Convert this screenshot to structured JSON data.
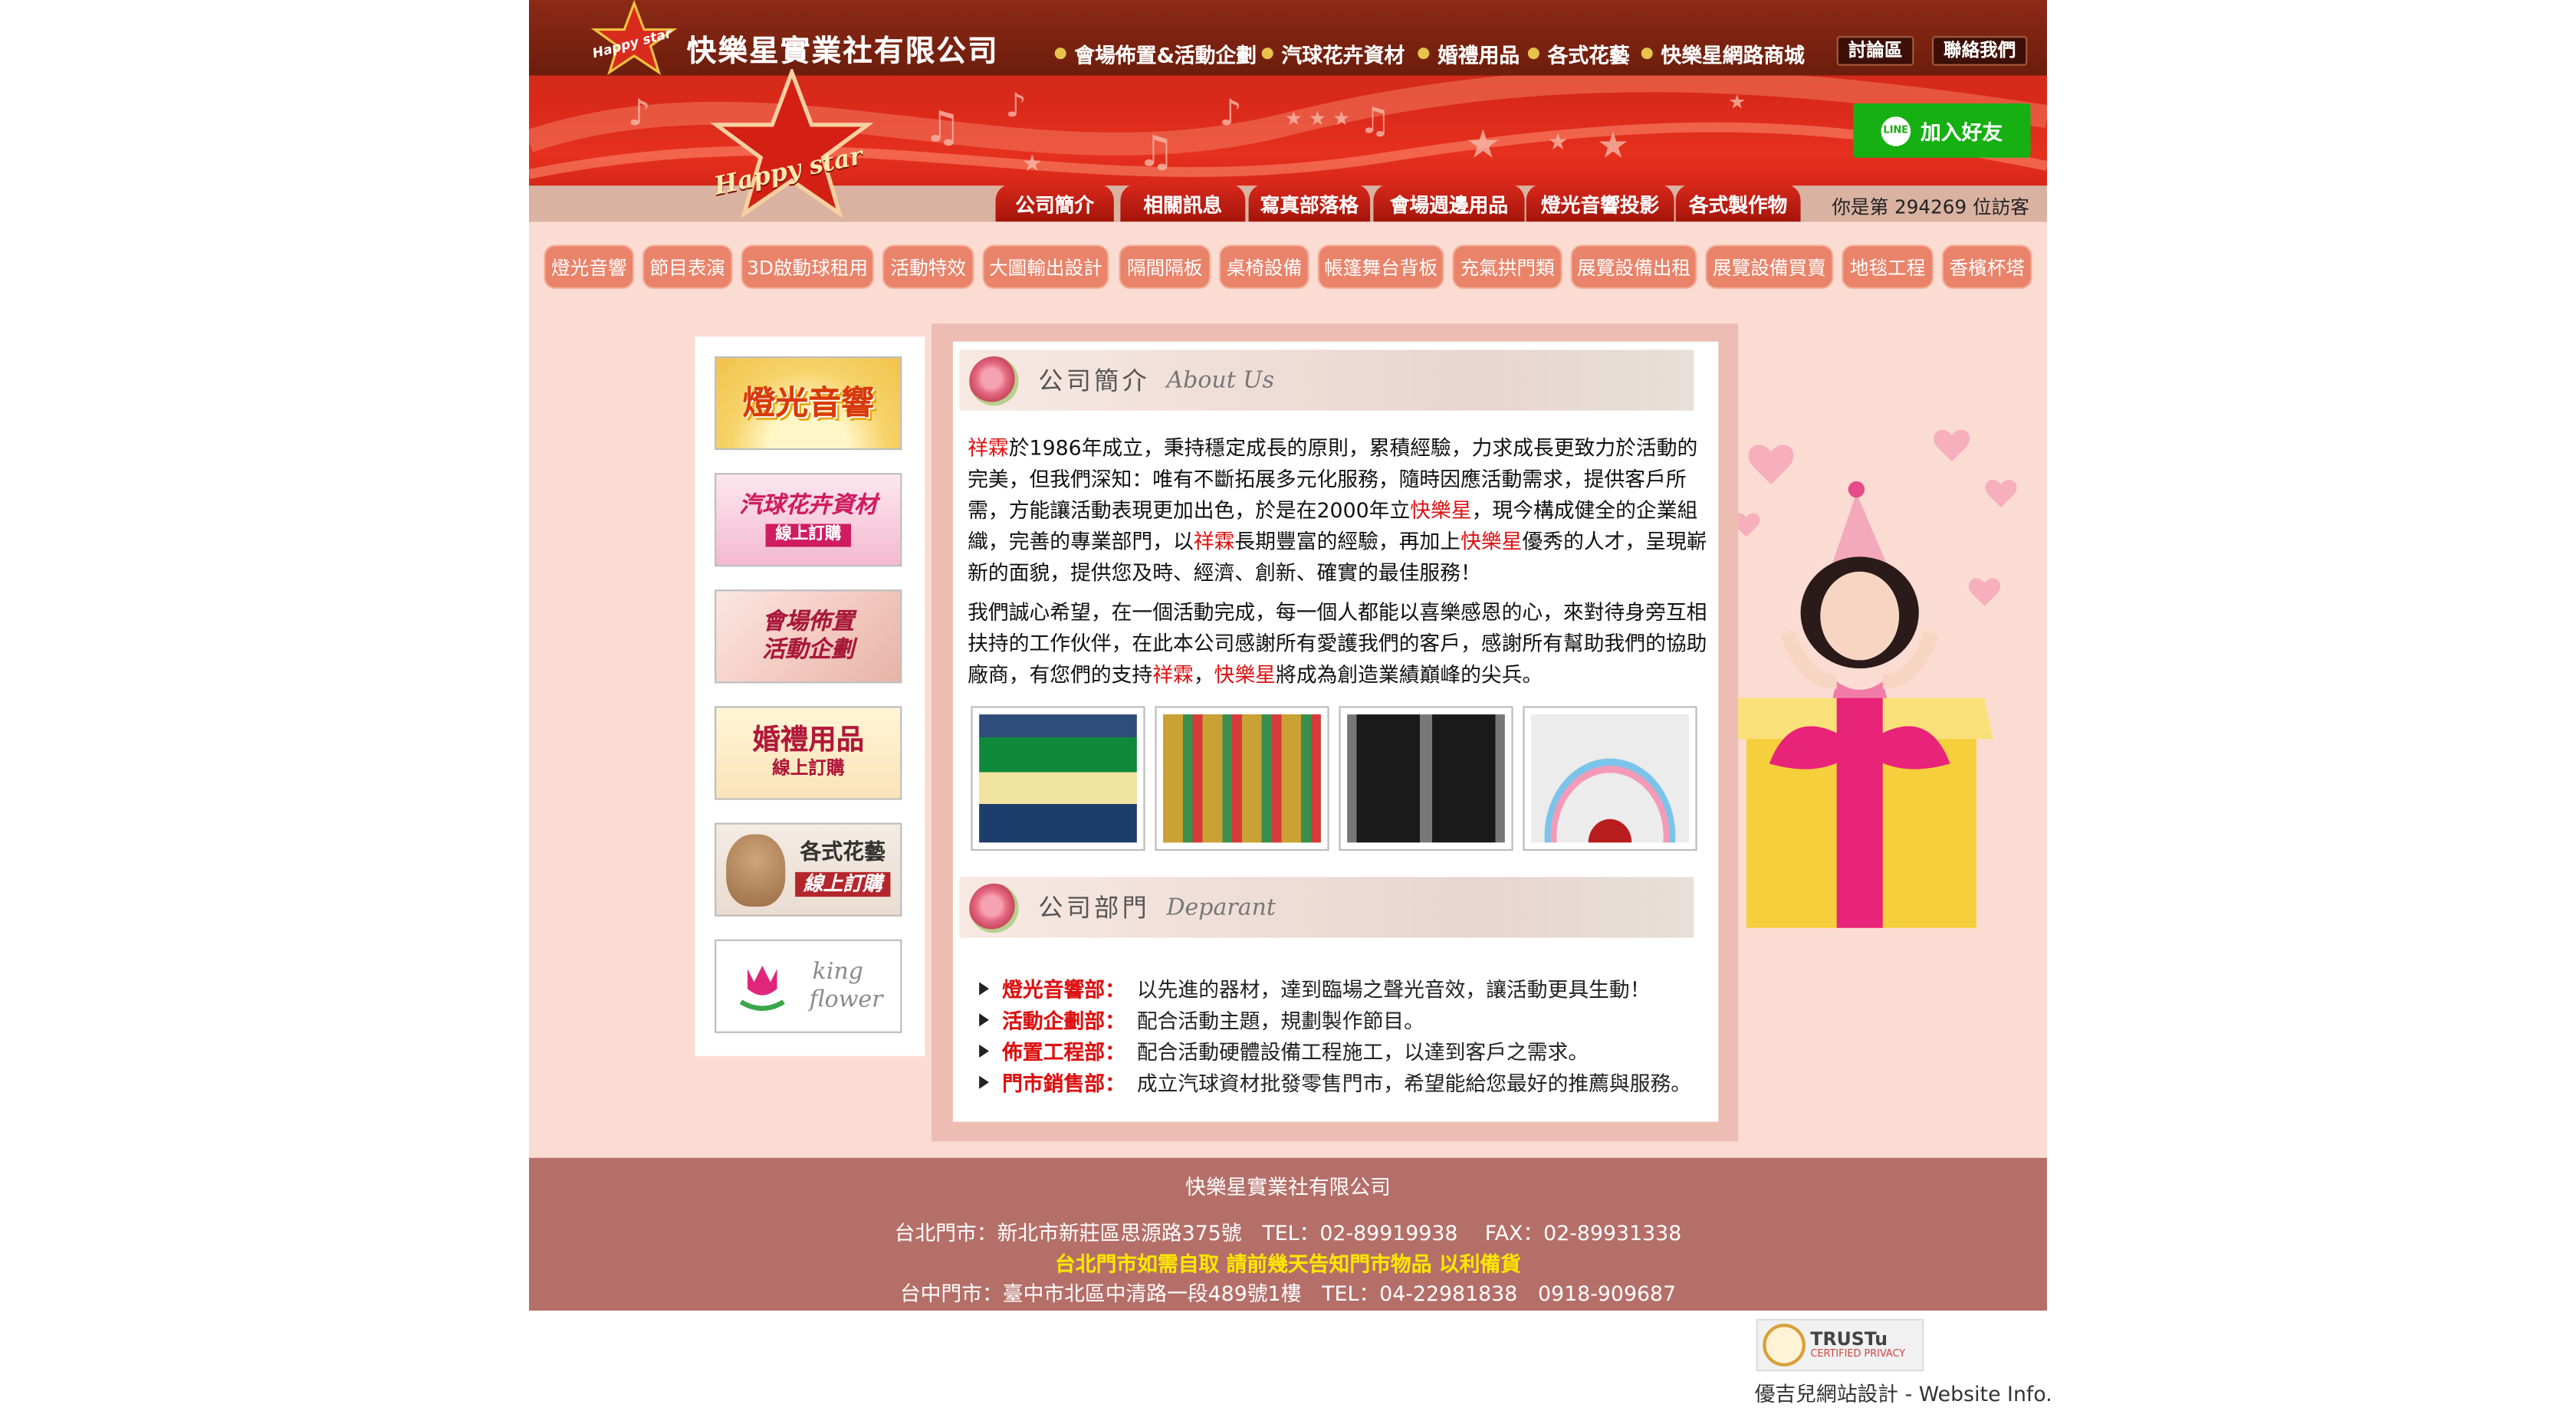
{
  "brand": {
    "name": "快樂星實業社有限公司",
    "logo_text": "Happy star"
  },
  "topnav": {
    "items": [
      "會場佈置&活動企劃",
      "汽球花卉資材",
      "婚禮用品",
      "各式花藝",
      "快樂星網路商城"
    ]
  },
  "top_buttons": {
    "forum": "討論區",
    "contact": "聯絡我們"
  },
  "line_button": {
    "label": "加入好友",
    "icon_text": "LINE"
  },
  "tabs": [
    "公司簡介",
    "相關訊息",
    "寫真部落格",
    "會場週邊用品",
    "燈光音響投影",
    "各式製作物"
  ],
  "visitor": {
    "prefix": "你是第",
    "count": "294269",
    "suffix": "位訪客"
  },
  "categories": [
    "燈光音響",
    "節目表演",
    "3D啟動球租用",
    "活動特效",
    "大圖輸出設計",
    "隔間隔板",
    "桌椅設備",
    "帳篷舞台背板",
    "充氣拱門類",
    "展覽設備出租",
    "展覽設備買賣",
    "地毯工程",
    "香檳杯塔"
  ],
  "sidebar": [
    {
      "title": "燈光音響",
      "subtitle": ""
    },
    {
      "title": "汽球花卉資材",
      "subtitle": "線上訂購"
    },
    {
      "title": "會場佈置",
      "subtitle": "活動企劃"
    },
    {
      "title": "婚禮用品",
      "subtitle": "線上訂購"
    },
    {
      "title": "各式花藝",
      "subtitle": "線上訂購"
    },
    {
      "title": "king",
      "subtitle": "flower"
    }
  ],
  "about": {
    "title": "公司簡介",
    "title_en": "About Us",
    "p1": [
      {
        "t": "祥霖",
        "red": true
      },
      {
        "t": "於1986年成立，秉持穩定成長的原則，累積經驗，力求成長更致力於活動的完美，但我們深知：唯有不斷拓展多元化服務，隨時因應活動需求，提供客戶所需，方能讓活動表現更加出色，於是在2000年立",
        "red": false
      },
      {
        "t": "快樂星",
        "red": true
      },
      {
        "t": "，現今構成健全的企業組織，完善的專業部門，以",
        "red": false
      },
      {
        "t": "祥霖",
        "red": true
      },
      {
        "t": "長期豐富的經驗，再加上",
        "red": false
      },
      {
        "t": "快樂星",
        "red": true
      },
      {
        "t": "優秀的人才，呈現嶄新的面貌，提供您及時、經濟、創新、確實的最佳服務！",
        "red": false
      }
    ],
    "p2": [
      {
        "t": "我們誠心希望，在一個活動完成，每一個人都能以喜樂感恩的心，來對待身旁互相扶持的工作伙伴，在此本公司感謝所有愛護我們的客戶，感謝所有幫助我們的協助廠商，有您們的支持",
        "red": false
      },
      {
        "t": "祥霖",
        "red": true
      },
      {
        "t": "，",
        "red": false
      },
      {
        "t": "快樂星",
        "red": true
      },
      {
        "t": "將成為創造業績巔峰的尖兵。",
        "red": false
      }
    ]
  },
  "dept": {
    "title": "公司部門",
    "title_en": "Deparant",
    "items": [
      {
        "name": "燈光音響部：",
        "desc": "以先進的器材，達到臨場之聲光音效，讓活動更具生動！"
      },
      {
        "name": "活動企劃部：",
        "desc": "配合活動主題，規劃製作節目。"
      },
      {
        "name": "佈置工程部：",
        "desc": "配合活動硬體設備工程施工，以達到客戶之需求。"
      },
      {
        "name": "門市銷售部：",
        "desc": "成立汽球資材批發零售門市，希望能給您最好的推薦與服務。"
      }
    ]
  },
  "footer": {
    "company": "快樂星實業社有限公司",
    "taipei": "台北門市：新北市新莊區思源路375號　TEL：02-89919938　 FAX：02-89931338",
    "notice": "台北門市如需自取 請前幾天告知門市物品 以利備貨",
    "taichung": "台中門市：臺中市北區中清路一段489號1樓　TEL：04-22981838　0918-909687"
  },
  "trust_badge": {
    "title": "TRUSTu",
    "subtitle": "CERTIFIED PRIVACY"
  },
  "credit": {
    "text": "優吉兒網站設計 - Website Info."
  }
}
